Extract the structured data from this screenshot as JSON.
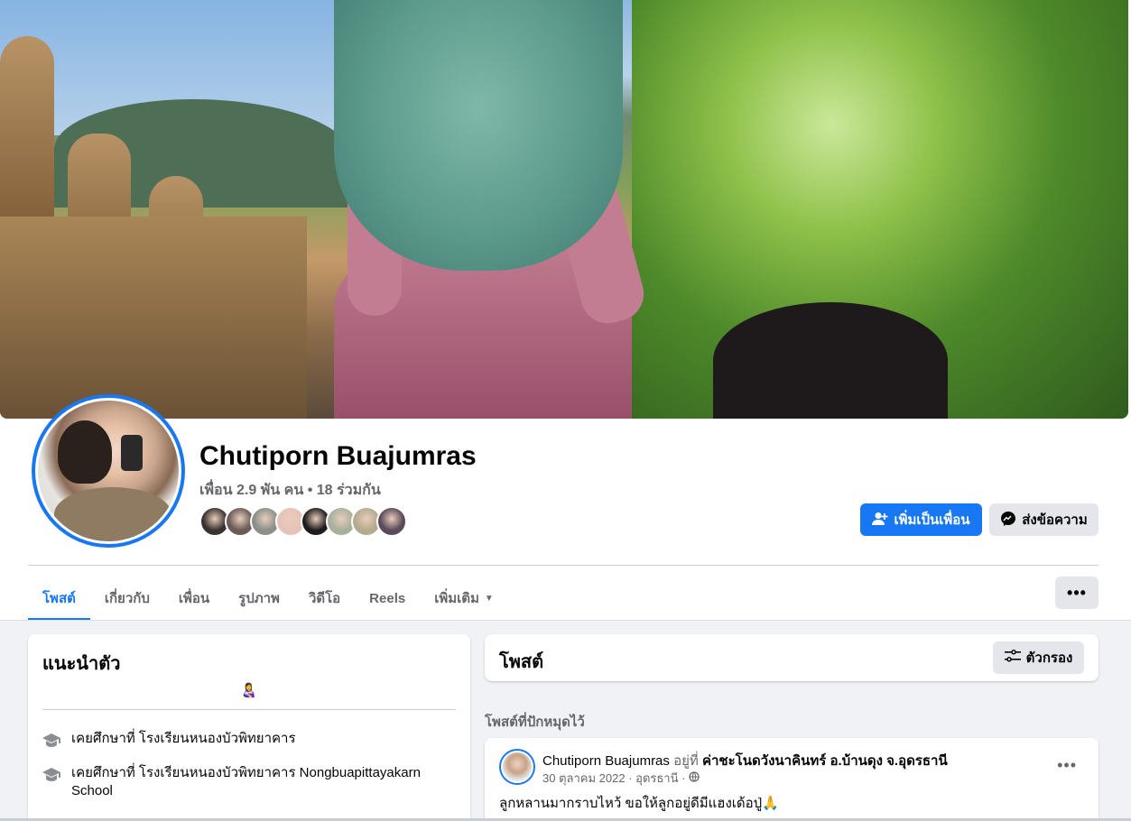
{
  "profile": {
    "name": "Chutiporn Buajumras",
    "friend_count": "เพื่อน 2.9 พัน คน • 18 ร่วมกัน",
    "mutual_friend_avatar_colors": [
      "#3a3230",
      "#6b5a58",
      "#8a8f8a",
      "#e7c2b8",
      "#1f1c1c",
      "#a7b09c",
      "#b3ab8e",
      "#5a4a5a"
    ]
  },
  "actions": {
    "add_friend": "เพิ่มเป็นเพื่อน",
    "message": "ส่งข้อความ",
    "more": "•••"
  },
  "tabs": [
    {
      "label": "โพสต์"
    },
    {
      "label": "เกี่ยวกับ"
    },
    {
      "label": "เพื่อน"
    },
    {
      "label": "รูปภาพ"
    },
    {
      "label": "วิดีโอ"
    },
    {
      "label": "Reels"
    },
    {
      "label": "เพิ่มเติม"
    }
  ],
  "intro": {
    "title": "แนะนำตัว",
    "bio_emoji": "👩‍🍼",
    "items": [
      {
        "prefix": "เคยศึกษาที่ ",
        "place": "โรงเรียนหนองบัวพิทยาคาร"
      },
      {
        "prefix": "เคยศึกษาที่ ",
        "place": "โรงเรียนหนองบัวพิทยาคาร Nongbuapittayakarn School"
      }
    ]
  },
  "posts": {
    "title": "โพสต์",
    "filter_label": "ตัวกรอง",
    "pinned_label": "โพสต์ที่ปักหมุดไว้",
    "pinned_post": {
      "author": "Chutiporn Buajumras",
      "at_word": "อยู่ที่",
      "place": "ค่าชะโนดวังนาคินทร์ อ.บ้านดุง จ.อุดรธานี",
      "meta": "30 ตุลาคม 2022 · อุดรธานี · ",
      "text": "ลูกหลานมากราบไหว้ ขอให้ลูกอยู่ดีมีแฮงเด้อปู่🙏",
      "more": "•••"
    }
  },
  "colors": {
    "accent": "#1877f2",
    "secondary_button": "#e4e6eb",
    "muted_text": "#65676b",
    "page_bg": "#f0f2f5"
  }
}
